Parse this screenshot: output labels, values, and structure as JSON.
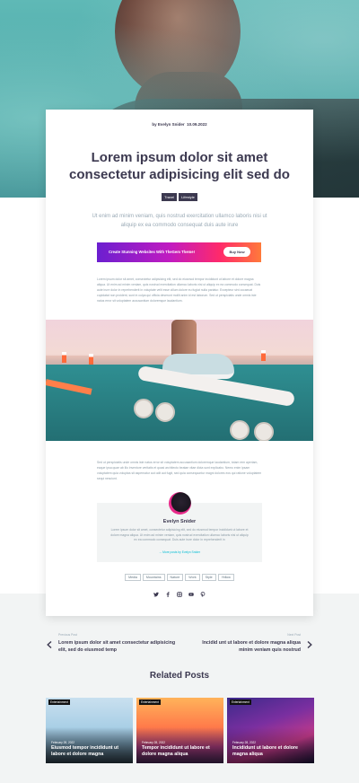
{
  "post": {
    "byline": "by Evelyn Snider",
    "date": "10.09.2022",
    "title": "Lorem ipsum dolor sit amet consectetur adipisicing elit sed do",
    "tags": [
      "Travel",
      "Lifestyle"
    ],
    "lead": "Ut enim ad minim veniam, quis nostrud exercitation ullamco laboris nisi ut aliquip ex ea commodo consequat duis aute irure",
    "banner": {
      "text": "Create Stunning Websites With TheGem Theme!",
      "button": "Buy Now"
    },
    "paragraph1": "Lorem ipsum dolor sit amet, consectetur adipisicing elit, sed do eiusmod tempor incididunt ut labore et dolore magna aliqua. Ut enim ad minim veniam, quis nostrud exercitation ullamco laboris nisi ut aliquip ex ea commodo consequat. Duis aute irure dolor in reprehenderit in voluptate velit esse cillum dolore eu fugiat nulla pariatur. Excepteur sint occaecat cupidatat non proident, sunt in culpa qui officia deserunt mollit anim id est laborum. Sed ut perspiciatis unde omnis iste natus error sit voluptatem accusantium doloremque laudantium.",
    "paragraph2": "Sed ut perspiciatis unde omnis iste natus error sit voluptatem accusantium doloremque laudantium, totam rem aperiam, eaque ipsa quae ab illo inventore veritatis et quasi architecto beatae vitae dicta sunt explicabo. Nemo enim ipsam voluptatem quia voluptas sit aspernatur aut odit aut fugit, sed quia consequuntur magni dolores eos qui ratione voluptatem sequi nesciunt."
  },
  "author": {
    "name": "Evelyn Snider",
    "bio": "Lorem ipsum dolor sit amet, consectetur adipisicing elit, sed do eiusmod tempor incididunt ut labore et dolore magna aliqua. Ut enim ad minim veniam, quis nostrud exercitation ullamco laboris nisi ut aliquip ex ea commodo consequat. Duis aute irure dolor in reprehenderit in",
    "more_link": "→ More posts by Evelyn Snider"
  },
  "post_tags": [
    "Media",
    "Mountains",
    "Nature",
    "Work",
    "Style",
    "Yellow"
  ],
  "social": [
    "twitter-icon",
    "facebook-icon",
    "instagram-icon",
    "youtube-icon",
    "pinterest-icon"
  ],
  "navigation": {
    "prev_label": "Previous Post",
    "prev_title": "Lorem ipsum dolor sit amet consectetur adipisicing elit, sed do eiusmod temp",
    "next_label": "Next Post",
    "next_title": "Incidid unt ut labore et dolore magna aliqua minim veniam quis nostrud"
  },
  "related": {
    "heading": "Related Posts",
    "items": [
      {
        "category": "Entertainment",
        "date": "February 28, 2022",
        "title": "Eiusmod tempor incididunt ut labore et dolore magna"
      },
      {
        "category": "Entertainment",
        "date": "February 28, 2022",
        "title": "Tempor incididunt ut labore et dolore magna aliqua"
      },
      {
        "category": "Entertainment",
        "date": "February 28, 2022",
        "title": "Incididunt ut labore et dolore magna aliqua"
      }
    ]
  }
}
